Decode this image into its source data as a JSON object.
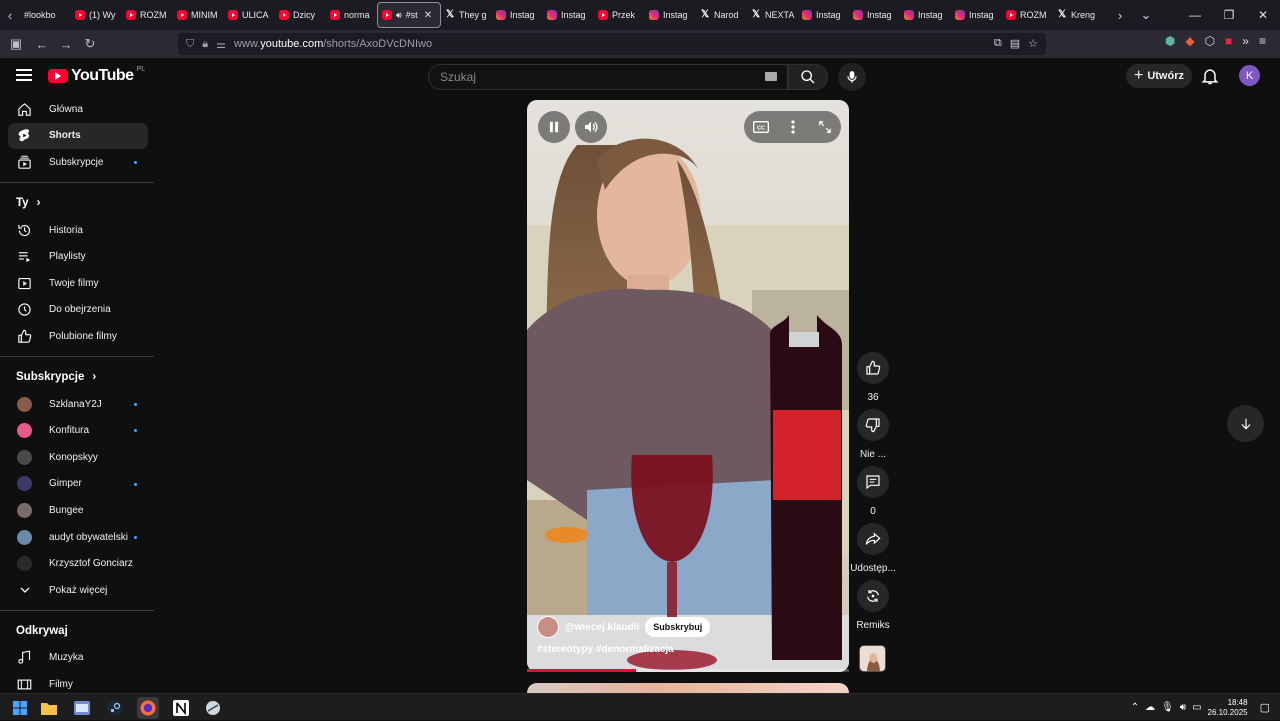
{
  "browser": {
    "tabs": [
      {
        "icon": "none",
        "title": "#lookbo"
      },
      {
        "icon": "youtube",
        "title": "(1) Wy"
      },
      {
        "icon": "youtube",
        "title": "ROZM"
      },
      {
        "icon": "youtube",
        "title": "MINIM"
      },
      {
        "icon": "youtube",
        "title": "ULICA"
      },
      {
        "icon": "youtube",
        "title": "Dzicy"
      },
      {
        "icon": "youtube",
        "title": "norma"
      },
      {
        "icon": "youtube",
        "title": "#st"
      },
      {
        "icon": "x",
        "title": "They g"
      },
      {
        "icon": "instagram",
        "title": "Instag"
      },
      {
        "icon": "instagram",
        "title": "Instag"
      },
      {
        "icon": "youtube",
        "title": "Przek"
      },
      {
        "icon": "instagram",
        "title": "Instag"
      },
      {
        "icon": "x",
        "title": "Narod"
      },
      {
        "icon": "x",
        "title": "NEXTA"
      },
      {
        "icon": "instagram",
        "title": "Instag"
      },
      {
        "icon": "instagram",
        "title": "Instag"
      },
      {
        "icon": "instagram",
        "title": "Instag"
      },
      {
        "icon": "instagram",
        "title": "Instag"
      },
      {
        "icon": "youtube",
        "title": "ROZM"
      },
      {
        "icon": "x",
        "title": "Kreng"
      }
    ],
    "url_prefix": "www.",
    "url_host": "youtube.com",
    "url_path": "/shorts/AxoDVcDNIwo"
  },
  "yt": {
    "logo_text": "YouTube",
    "country_code": "PL",
    "search_placeholder": "Szukaj",
    "create_label": "Utwórz",
    "avatar_letter": "K"
  },
  "sidebar": {
    "main": [
      {
        "label": "Główna",
        "icon": "home-icon"
      },
      {
        "label": "Shorts",
        "icon": "shorts-icon"
      },
      {
        "label": "Subskrypcje",
        "icon": "subscriptions-icon"
      }
    ],
    "you_title": "Ty",
    "you": [
      {
        "label": "Historia",
        "icon": "history-icon"
      },
      {
        "label": "Playlisty",
        "icon": "playlists-icon"
      },
      {
        "label": "Twoje filmy",
        "icon": "your-videos-icon"
      },
      {
        "label": "Do obejrzenia",
        "icon": "watch-later-icon"
      },
      {
        "label": "Polubione filmy",
        "icon": "liked-icon"
      }
    ],
    "subs_title": "Subskrypcje",
    "subs": [
      {
        "label": "SzklanaY2J",
        "color": "#8a5a4a"
      },
      {
        "label": "Konfitura",
        "color": "#e85a8a"
      },
      {
        "label": "Konopskyy",
        "color": "#4a4a4a"
      },
      {
        "label": "Gimper",
        "color": "#3a3a6a"
      },
      {
        "label": "Bungee",
        "color": "#7a6a6a"
      },
      {
        "label": "audyt obywatelski",
        "color": "#6a8aaa"
      },
      {
        "label": "Krzysztof Gonciarz",
        "color": "#2a2a2a"
      }
    ],
    "show_more": "Pokaż więcej",
    "explore_title": "Odkrywaj",
    "explore": [
      {
        "label": "Muzyka",
        "icon": "music-icon"
      },
      {
        "label": "Filmy",
        "icon": "movies-icon"
      }
    ]
  },
  "short": {
    "channel": "@wiecej.klaudii",
    "subscribe_label": "Subskrybuj",
    "hashtags": "#stereotypy #denormalizacja",
    "progress": 0.34,
    "actions": {
      "like_count": "36",
      "dislike_label": "Nie ...",
      "comments_count": "0",
      "share_label": "Udostęp...",
      "remix_label": "Remiks"
    }
  },
  "taskbar": {
    "time": "18:48",
    "date": "26.10.2025"
  }
}
